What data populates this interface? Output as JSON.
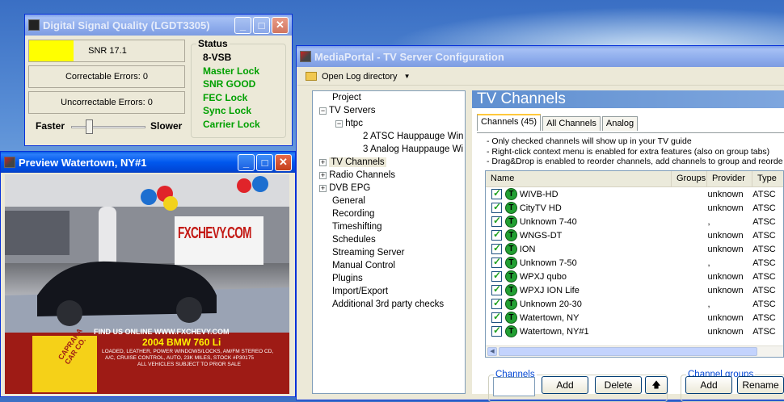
{
  "dsq": {
    "title": "Digital Signal Quality (LGDT3305)",
    "snr": "SNR 17.1",
    "correctable": "Correctable Errors:  0",
    "uncorrectable": "Uncorrectable Errors:  0",
    "faster": "Faster",
    "slower": "Slower",
    "status_heading": "Status",
    "status": [
      "8-VSB",
      "Master Lock",
      "SNR GOOD",
      "FEC Lock",
      "Sync Lock",
      "Carrier Lock"
    ],
    "snr_color": "#ffff00",
    "lock_color": "#00a000"
  },
  "preview": {
    "title": "Preview Watertown, NY#1",
    "wall_sign": "FXCHEVY.COM",
    "banner1": "FIND US ONLINE WWW.FXCHEVY.COM",
    "banner2": "2004 BMW 760 Li",
    "banner3": "LOADED, LEATHER, POWER WINDOWS/LOCKS, AM/FM STEREO CD,",
    "banner4": "A/C, CRUISE CONTROL, AUTO, 23K MILES, STOCK #P30175",
    "banner5": "ALL VEHICLES SUBJECT TO PRIOR SALE",
    "logo_text": "CAPRARA CAR CO."
  },
  "mp": {
    "title": "MediaPortal - TV Server Configuration",
    "menu_open_log": "Open Log directory",
    "tree": [
      {
        "label": "Project"
      },
      {
        "label": "TV Servers"
      },
      {
        "label": "htpc"
      },
      {
        "label": "2 ATSC Hauppauge Win"
      },
      {
        "label": "3 Analog Hauppauge Wi"
      },
      {
        "label": "TV Channels"
      },
      {
        "label": "Radio Channels"
      },
      {
        "label": "DVB EPG"
      },
      {
        "label": "General"
      },
      {
        "label": "Recording"
      },
      {
        "label": "Timeshifting"
      },
      {
        "label": "Schedules"
      },
      {
        "label": "Streaming Server"
      },
      {
        "label": "Manual Control"
      },
      {
        "label": "Plugins"
      },
      {
        "label": "Import/Export"
      },
      {
        "label": "Additional 3rd party checks"
      }
    ],
    "header": "TV Channels",
    "tabs": [
      "Channels (45)",
      "All Channels",
      "Analog"
    ],
    "info": [
      "- Only checked channels will show up in your TV guide",
      "- Right-click context menu is enabled for extra features (also on group tabs)",
      "- Drag&Drop is enabled to reorder channels, add channels to group and reorde"
    ],
    "columns": [
      "Name",
      "Groups",
      "Provider",
      "Type"
    ],
    "channels": [
      {
        "name": "WIVB-HD",
        "provider": "unknown",
        "type": "ATSC"
      },
      {
        "name": "CityTV HD",
        "provider": "unknown",
        "type": "ATSC"
      },
      {
        "name": "Unknown 7-40",
        "provider": ",",
        "type": "ATSC"
      },
      {
        "name": "WNGS-DT",
        "provider": "unknown",
        "type": "ATSC"
      },
      {
        "name": "ION",
        "provider": "unknown",
        "type": "ATSC"
      },
      {
        "name": "Unknown 7-50",
        "provider": ",",
        "type": "ATSC"
      },
      {
        "name": "WPXJ qubo",
        "provider": "unknown",
        "type": "ATSC"
      },
      {
        "name": "WPXJ ION Life",
        "provider": "unknown",
        "type": "ATSC"
      },
      {
        "name": "Unknown 20-30",
        "provider": ",",
        "type": "ATSC"
      },
      {
        "name": "Watertown, NY",
        "provider": "unknown",
        "type": "ATSC"
      },
      {
        "name": "Watertown, NY#1",
        "provider": "unknown",
        "type": "ATSC"
      }
    ],
    "channels_group_label": "Channels",
    "channel_groups_label": "Channel groups",
    "add": "Add",
    "delete": "Delete",
    "rename": "Rename",
    "up_arrow": "🡅"
  }
}
